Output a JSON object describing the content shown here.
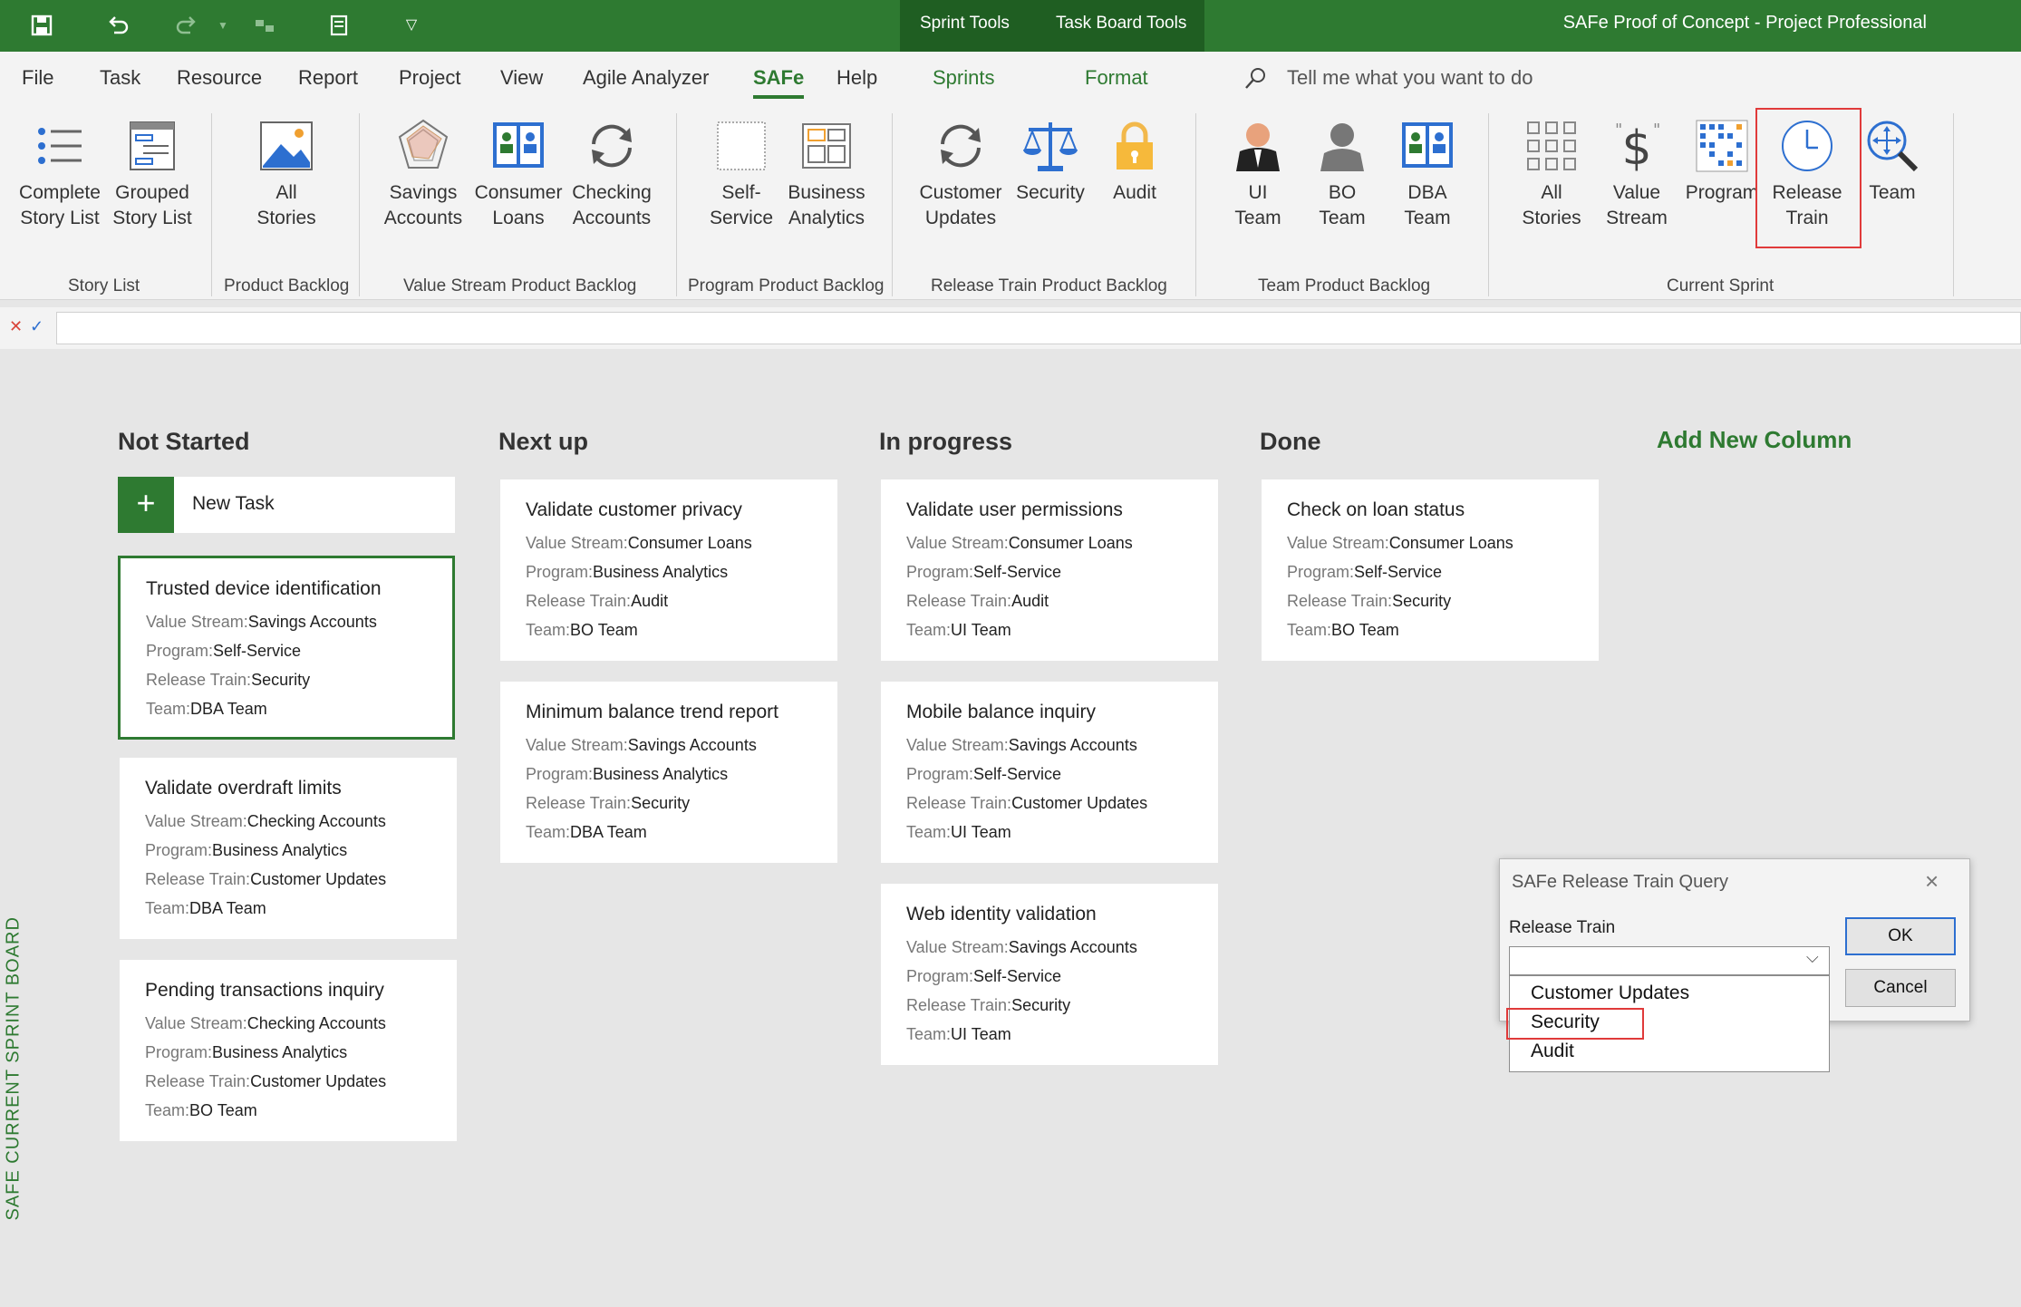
{
  "titlebar": {
    "contextual_tabs": [
      "Sprint Tools",
      "Task Board Tools"
    ],
    "app_title": "SAFe Proof of Concept  -  Project Professional"
  },
  "ribbon_tabs": [
    "File",
    "Task",
    "Resource",
    "Report",
    "Project",
    "View",
    "Agile Analyzer",
    "SAFe",
    "Help",
    "Sprints",
    "Format"
  ],
  "active_tab": "SAFe",
  "tell_me": "Tell me what you want to do",
  "ribbon": {
    "groups": [
      "Story List",
      "Product Backlog",
      "Value Stream Product Backlog",
      "Program Product Backlog",
      "Release Train Product Backlog",
      "Team Product Backlog",
      "Current Sprint"
    ],
    "buttons": {
      "complete_story_list": [
        "Complete",
        "Story List"
      ],
      "grouped_story_list": [
        "Grouped",
        "Story List"
      ],
      "all_stories": [
        "All",
        "Stories"
      ],
      "savings_accounts": [
        "Savings",
        "Accounts"
      ],
      "consumer_loans": [
        "Consumer",
        "Loans"
      ],
      "checking_accounts": [
        "Checking",
        "Accounts"
      ],
      "self_service": [
        "Self-",
        "Service"
      ],
      "business_analytics": [
        "Business",
        "Analytics"
      ],
      "customer_updates": [
        "Customer",
        "Updates"
      ],
      "security": [
        "Security"
      ],
      "audit": [
        "Audit"
      ],
      "ui_team": [
        "UI",
        "Team"
      ],
      "bo_team": [
        "BO",
        "Team"
      ],
      "dba_team": [
        "DBA",
        "Team"
      ],
      "cs_all_stories": [
        "All",
        "Stories"
      ],
      "value_stream": [
        "Value",
        "Stream"
      ],
      "program": [
        "Program"
      ],
      "release_train": [
        "Release",
        "Train"
      ],
      "team": [
        "Team"
      ]
    }
  },
  "board": {
    "side_label": "SAFE CURRENT SPRINT BOARD",
    "add_column": "Add New Column",
    "new_task": "New Task",
    "field_labels": {
      "value_stream": "Value Stream:",
      "program": "Program:",
      "release_train": "Release Train:",
      "team": "Team:"
    },
    "columns": [
      {
        "title": "Not Started",
        "cards": [
          {
            "title": "Trusted device identification",
            "value_stream": "Savings Accounts",
            "program": "Self-Service",
            "release_train": "Security",
            "team": "DBA Team"
          },
          {
            "title": "Validate overdraft limits",
            "value_stream": "Checking Accounts",
            "program": "Business Analytics",
            "release_train": "Customer Updates",
            "team": "DBA Team"
          },
          {
            "title": "Pending transactions inquiry",
            "value_stream": "Checking Accounts",
            "program": "Business Analytics",
            "release_train": "Customer Updates",
            "team": "BO Team"
          }
        ]
      },
      {
        "title": "Next up",
        "cards": [
          {
            "title": "Validate customer privacy",
            "value_stream": "Consumer Loans",
            "program": "Business Analytics",
            "release_train": "Audit",
            "team": "BO Team"
          },
          {
            "title": "Minimum balance trend report",
            "value_stream": "Savings Accounts",
            "program": "Business Analytics",
            "release_train": "Security",
            "team": "DBA Team"
          }
        ]
      },
      {
        "title": "In progress",
        "cards": [
          {
            "title": "Validate user permissions",
            "value_stream": "Consumer Loans",
            "program": "Self-Service",
            "release_train": "Audit",
            "team": "UI Team"
          },
          {
            "title": "Mobile balance inquiry",
            "value_stream": "Savings Accounts",
            "program": "Self-Service",
            "release_train": "Customer Updates",
            "team": "UI Team"
          },
          {
            "title": "Web identity validation",
            "value_stream": "Savings Accounts",
            "program": "Self-Service",
            "release_train": "Security",
            "team": "UI Team"
          }
        ]
      },
      {
        "title": "Done",
        "cards": [
          {
            "title": "Check on loan status",
            "value_stream": "Consumer Loans",
            "program": "Self-Service",
            "release_train": "Security",
            "team": "BO Team"
          }
        ]
      }
    ]
  },
  "dialog": {
    "title": "SAFe Release Train Query",
    "field_label": "Release Train",
    "selected_value": "",
    "options": [
      "Customer Updates",
      "Security",
      "Audit"
    ],
    "ok": "OK",
    "cancel": "Cancel"
  },
  "colors": {
    "accent": "#2e7a31",
    "highlight": "#e03a3a"
  }
}
